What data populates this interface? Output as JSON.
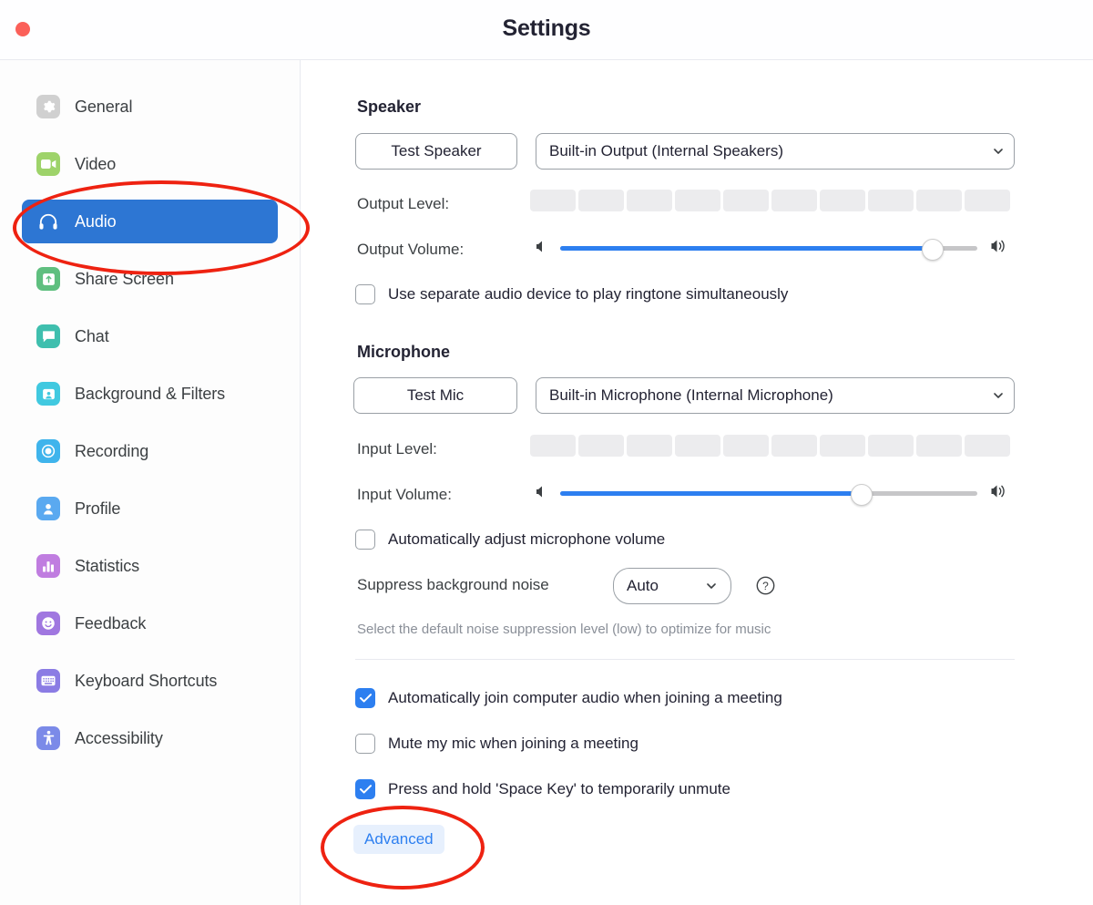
{
  "window": {
    "title": "Settings",
    "close_button": "close-window"
  },
  "sidebar": {
    "items": [
      {
        "label": "General",
        "icon": "gear-icon",
        "color": "#d0d0d0",
        "selected": false
      },
      {
        "label": "Video",
        "icon": "video-camera-icon",
        "color": "#9ed36a",
        "selected": false
      },
      {
        "label": "Audio",
        "icon": "headphones-icon",
        "color": "#2d76d3",
        "selected": true
      },
      {
        "label": "Share Screen",
        "icon": "upload-box-icon",
        "color": "#5fbf7f",
        "selected": false
      },
      {
        "label": "Chat",
        "icon": "chat-bubble-icon",
        "color": "#3fbfae",
        "selected": false
      },
      {
        "label": "Background & Filters",
        "icon": "person-frame-icon",
        "color": "#41c9e0",
        "selected": false
      },
      {
        "label": "Recording",
        "icon": "record-circle-icon",
        "color": "#3fb4ec",
        "selected": false
      },
      {
        "label": "Profile",
        "icon": "person-icon",
        "color": "#5aa9f0",
        "selected": false
      },
      {
        "label": "Statistics",
        "icon": "bar-chart-icon",
        "color": "#c07de0",
        "selected": false
      },
      {
        "label": "Feedback",
        "icon": "smiley-icon",
        "color": "#a077e0",
        "selected": false
      },
      {
        "label": "Keyboard Shortcuts",
        "icon": "keyboard-icon",
        "color": "#8b7ce4",
        "selected": false
      },
      {
        "label": "Accessibility",
        "icon": "accessibility-icon",
        "color": "#7b8ae8",
        "selected": false
      }
    ]
  },
  "speaker": {
    "heading": "Speaker",
    "test_button": "Test Speaker",
    "device": "Built-in Output (Internal Speakers)",
    "output_level_label": "Output Level:",
    "output_level_segments": 10,
    "output_level_value": 0,
    "output_volume_label": "Output Volume:",
    "output_volume_percent": 89,
    "ringtone_checkbox": {
      "label": "Use separate audio device to play ringtone simultaneously",
      "checked": false
    }
  },
  "microphone": {
    "heading": "Microphone",
    "test_button": "Test Mic",
    "device": "Built-in Microphone (Internal Microphone)",
    "input_level_label": "Input Level:",
    "input_level_segments": 10,
    "input_level_value": 0,
    "input_volume_label": "Input Volume:",
    "input_volume_percent": 72,
    "auto_adjust_checkbox": {
      "label": "Automatically adjust microphone volume",
      "checked": false
    },
    "suppress_label": "Suppress background noise",
    "suppress_value": "Auto",
    "suppress_hint": "Select the default noise suppression level (low) to optimize for music"
  },
  "options": [
    {
      "label": "Automatically join computer audio when joining a meeting",
      "checked": true
    },
    {
      "label": "Mute my mic when joining a meeting",
      "checked": false
    },
    {
      "label": "Press and hold 'Space Key' to temporarily unmute",
      "checked": true
    }
  ],
  "advanced_button": "Advanced",
  "colors": {
    "accent_blue": "#2d7ff0",
    "selected_nav": "#2d76d3",
    "annotation_red": "#ee2211",
    "link_blue": "#2d7ff0",
    "advanced_bg": "#e7f0fd"
  },
  "annotations": [
    {
      "name": "audio-nav-highlight"
    },
    {
      "name": "advanced-button-highlight"
    }
  ]
}
